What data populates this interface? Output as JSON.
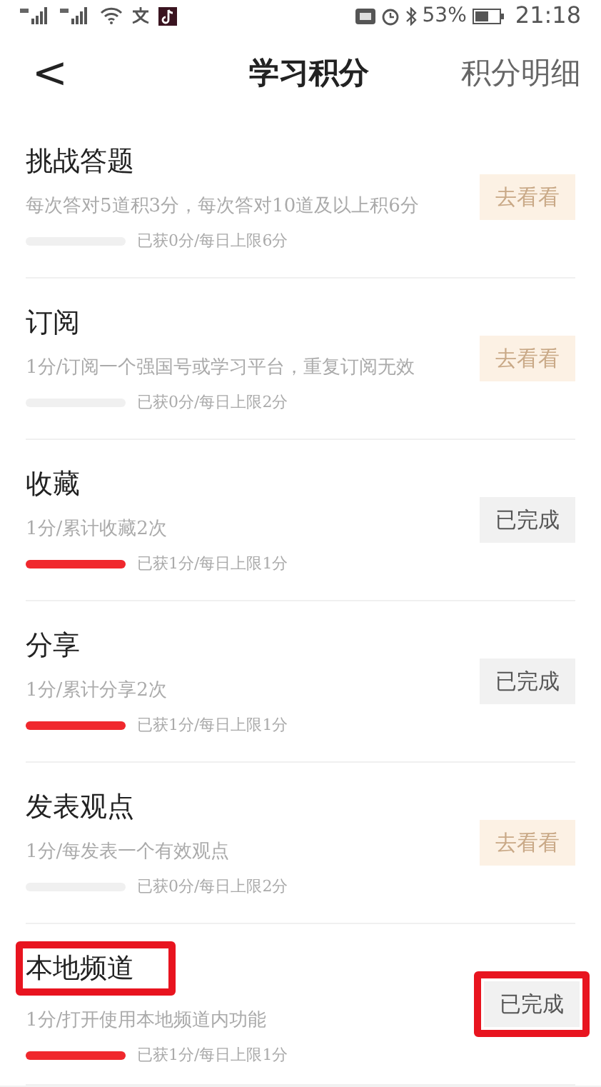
{
  "status_bar": {
    "battery": "53%",
    "time": "21:18"
  },
  "header": {
    "back": "<",
    "title": "学习积分",
    "action": "积分明细"
  },
  "tasks": [
    {
      "title": "挑战答题",
      "description": "每次答对5道积3分，每次答对10道及以上积6分",
      "progress": "已获0分/每日上限6分",
      "level": 0,
      "button": {
        "kind": "go",
        "label": "去看看"
      },
      "highlight": false,
      "button_highlight": false
    },
    {
      "title": "订阅",
      "description": "1分/订阅一个强国号或学习平台，重复订阅无效",
      "progress": "已获0分/每日上限2分",
      "level": 0,
      "button": {
        "kind": "go",
        "label": "去看看"
      },
      "highlight": false,
      "button_highlight": false
    },
    {
      "title": "收藏",
      "description": "1分/累计收藏2次",
      "progress": "已获1分/每日上限1分",
      "level": 1,
      "button": {
        "kind": "done",
        "label": "已完成"
      },
      "highlight": false,
      "button_highlight": false
    },
    {
      "title": "分享",
      "description": "1分/累计分享2次",
      "progress": "已获1分/每日上限1分",
      "level": 1,
      "button": {
        "kind": "done",
        "label": "已完成"
      },
      "highlight": false,
      "button_highlight": false
    },
    {
      "title": "发表观点",
      "description": "1分/每发表一个有效观点",
      "progress": "已获0分/每日上限2分",
      "level": 0,
      "button": {
        "kind": "go",
        "label": "去看看"
      },
      "highlight": false,
      "button_highlight": false
    },
    {
      "title": "本地频道",
      "description": "1分/打开使用本地频道内功能",
      "progress": "已获1分/每日上限1分",
      "level": 1,
      "button": {
        "kind": "done",
        "label": "已完成"
      },
      "highlight": true,
      "button_highlight": true
    }
  ]
}
